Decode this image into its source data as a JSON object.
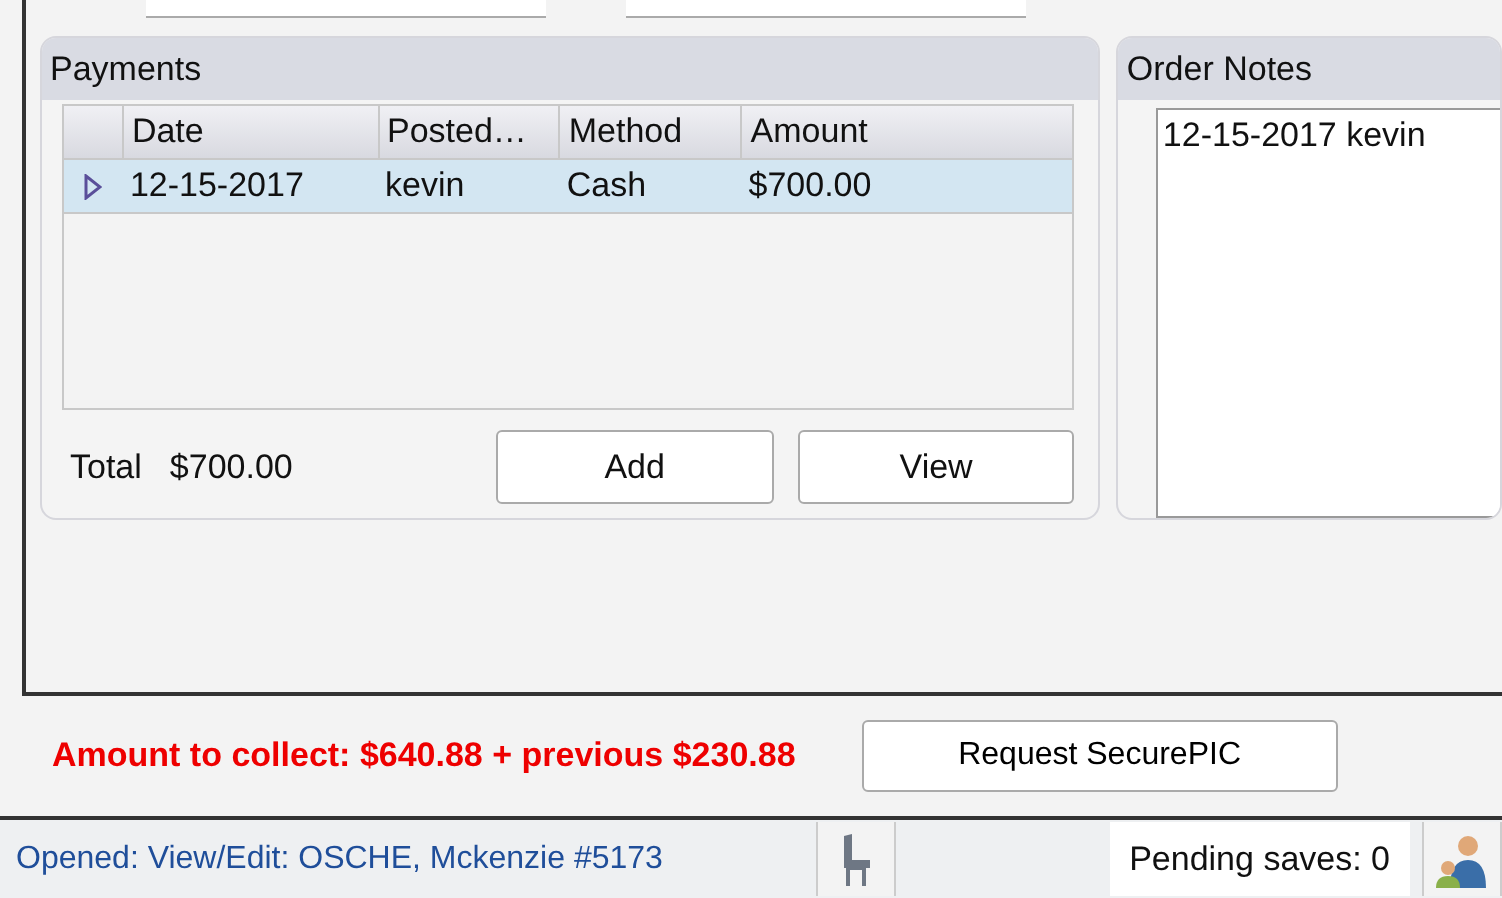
{
  "payments": {
    "title": "Payments",
    "columns": [
      "Date",
      "Posted…",
      "Method",
      "Amount"
    ],
    "rows": [
      {
        "cells": [
          "12-15-2017",
          "kevin",
          "Cash",
          "$700.00"
        ],
        "selected": true
      }
    ],
    "total_label": "Total",
    "total_value": "$700.00",
    "buttons": [
      "Add",
      "View"
    ]
  },
  "order_notes": {
    "title": "Order Notes",
    "text": "12-15-2017 kevin"
  },
  "amount_message": "Amount to collect: $640.88 + previous $230.88",
  "secure_button": "Request SecurePIC",
  "status_bar": {
    "opened": "Opened: View/Edit: OSCHE, Mckenzie #5173",
    "pending": "Pending saves: 0"
  }
}
